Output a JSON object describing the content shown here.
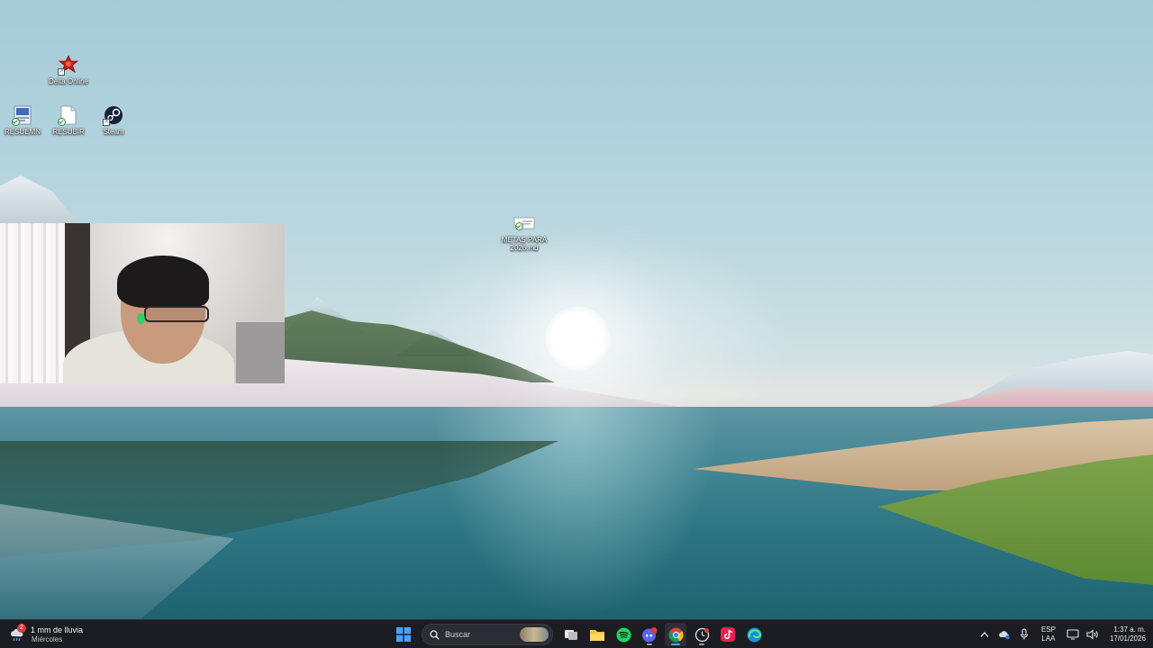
{
  "desktop": {
    "icons": [
      {
        "id": "delta",
        "label": "Delta Online"
      },
      {
        "id": "resumen",
        "label": "RESUEMN"
      },
      {
        "id": "resubir",
        "label": "RESUBIR"
      },
      {
        "id": "steam",
        "label": "Steam"
      },
      {
        "id": "metas",
        "label": "METAS PARA\n2026.md"
      }
    ]
  },
  "taskbar": {
    "weather": {
      "line1": "1 mm de lluvia",
      "line2": "Miércoles",
      "badge": "2",
      "icon": "rain-cloud-icon"
    },
    "search": {
      "placeholder": "Buscar"
    },
    "apps": [
      {
        "name": "start",
        "icon": "windows-logo-icon"
      },
      {
        "name": "task-view",
        "icon": "task-view-icon"
      },
      {
        "name": "file-explorer",
        "icon": "folder-icon"
      },
      {
        "name": "spotify",
        "icon": "spotify-icon"
      },
      {
        "name": "discord",
        "icon": "discord-icon",
        "badge": "9+"
      },
      {
        "name": "chrome",
        "icon": "chrome-icon"
      },
      {
        "name": "app-clock",
        "icon": "clock-app-icon"
      },
      {
        "name": "tiktok",
        "icon": "tiktok-icon"
      },
      {
        "name": "edge",
        "icon": "edge-icon"
      }
    ],
    "tray": {
      "language": {
        "line1": "ESP",
        "line2": "LAA"
      },
      "clock": {
        "time": "1:37 a. m.",
        "date": "17/01/2026"
      }
    }
  },
  "colors": {
    "taskbar_bg": "#1c1d22",
    "accent_blue": "#4aa3ff",
    "spotify": "#1ed760",
    "discord": "#5865f2"
  }
}
